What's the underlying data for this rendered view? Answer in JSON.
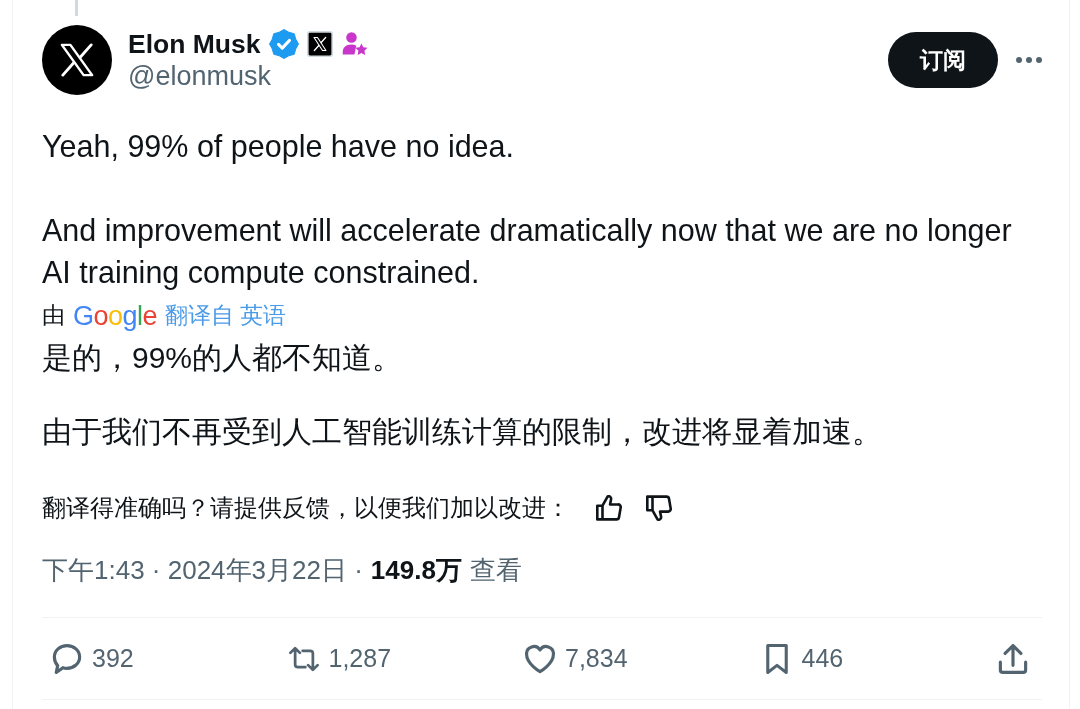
{
  "tweet": {
    "author": {
      "name": "Elon Musk",
      "handle": "@elonmusk"
    },
    "subscribe_button": "订阅",
    "text_paragraphs": [
      "Yeah, 99% of people have no idea.",
      "And improvement will accelerate dramatically now that we are no longer AI training compute constrained."
    ],
    "translation": {
      "by": "由",
      "provider": "Google",
      "link": "翻译自 英语",
      "paragraphs": [
        "是的，99%的人都不知道。",
        "由于我们不再受到人工智能训练计算的限制，改进将显着加速。"
      ]
    },
    "feedback_prompt": "翻译得准确吗？请提供反馈，以便我们加以改进：",
    "meta": {
      "timestamp": "下午1:43 · 2024年3月22日 ·",
      "views": "149.8万",
      "views_label": "查看"
    },
    "actions": [
      {
        "kind": "reply",
        "count": "392"
      },
      {
        "kind": "repost",
        "count": "1,287"
      },
      {
        "kind": "like",
        "count": "7,834"
      },
      {
        "kind": "bookmark",
        "count": "446"
      },
      {
        "kind": "share"
      }
    ]
  }
}
